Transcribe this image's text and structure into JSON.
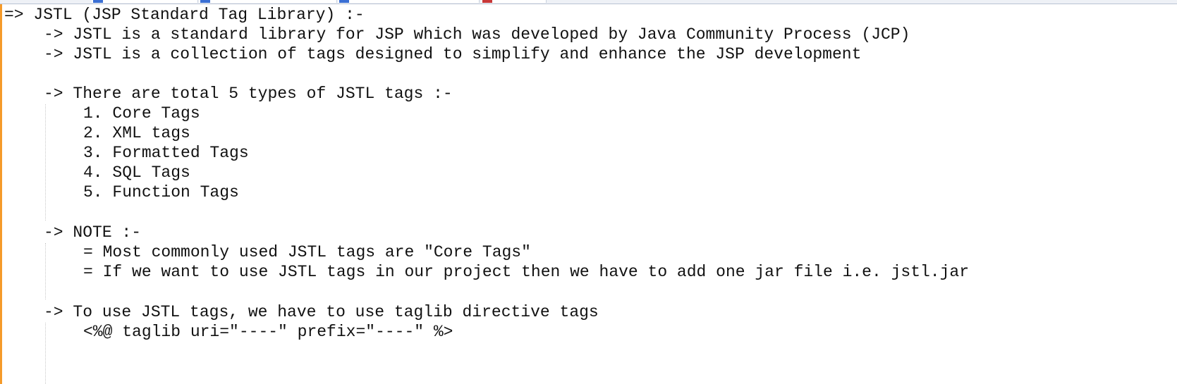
{
  "editor": {
    "lines": [
      "=> JSTL (JSP Standard Tag Library) :-",
      "-> JSTL is a standard library for JSP which was developed by Java Community Process (JCP)",
      "-> JSTL is a collection of tags designed to simplify and enhance the JSP development",
      "-> There are total 5 types of JSTL tags :-",
      "1. Core Tags",
      "2. XML tags",
      "3. Formatted Tags",
      "4. SQL Tags",
      "5. Function Tags",
      "-> NOTE :-",
      "= Most commonly used JSTL tags are \"Core Tags\"",
      "= If we want to use JSTL tags in our project then we have to add one jar file i.e. jstl.jar",
      "-> To use JSTL tags, we have to use taglib directive tags",
      "<%@ taglib uri=\"----\" prefix=\"----\" %>"
    ]
  },
  "colors": {
    "text": "#111111",
    "change_bar": "#f59a2a",
    "guide": "#c8c8c8"
  }
}
